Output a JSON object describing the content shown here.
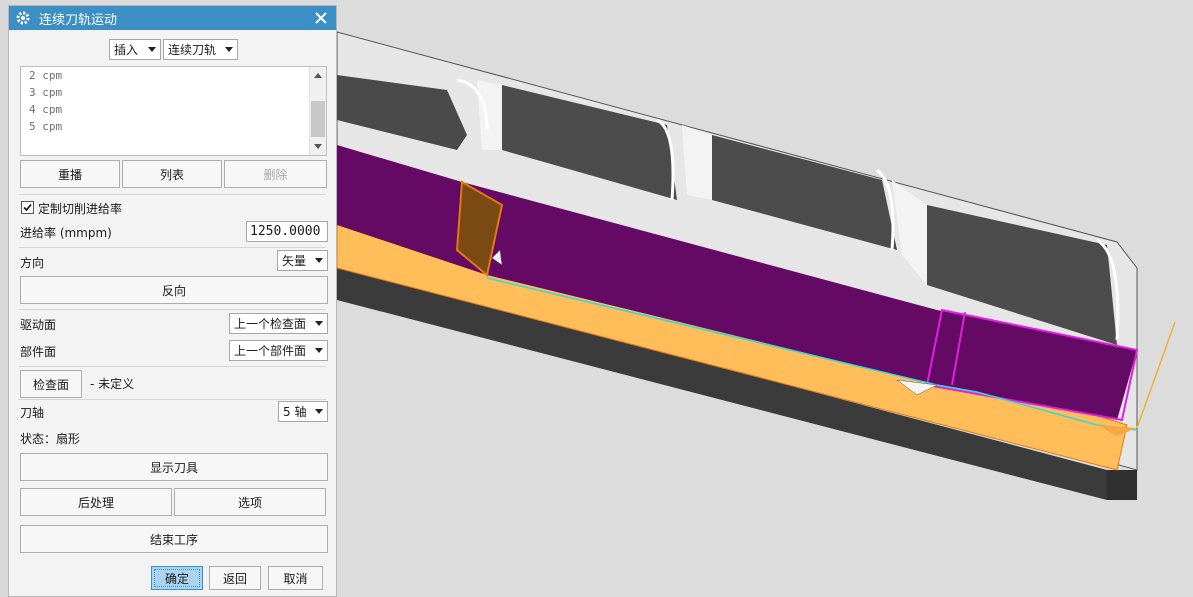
{
  "dialog": {
    "title": "连续刀轨运动",
    "insert_combo": "插入",
    "type_combo": "连续刀轨",
    "list_items": [
      "2  cpm",
      "3  cpm",
      "4  cpm",
      "5  cpm"
    ],
    "replay_button": "重播",
    "list_button": "列表",
    "delete_button": "删除",
    "custom_feed_label": "定制切削进给率",
    "custom_feed_checked": true,
    "feed_rate_label": "进给率 (mmpm)",
    "feed_rate_value": "1250.0000",
    "direction_label": "方向",
    "direction_value": "矢量",
    "reverse_button": "反向",
    "drive_surface_label": "驱动面",
    "drive_surface_value": "上一个检查面",
    "part_surface_label": "部件面",
    "part_surface_value": "上一个部件面",
    "check_surface_button": "检查面",
    "check_surface_status": "- 未定义",
    "tool_axis_label": "刀轴",
    "tool_axis_value": "5 轴",
    "status_text": "状态：扇形",
    "show_tool_button": "显示刀具",
    "postprocess_button": "后处理",
    "options_button": "选项",
    "end_operation_button": "结束工序",
    "ok_button": "确定",
    "back_button": "返回",
    "cancel_button": "取消"
  },
  "colors": {
    "titlebar": "#3c8fc4",
    "part_orange": "#ffbe5a",
    "wall_purple": "#650a64",
    "pocket_gray": "#4a4a4a",
    "highlight_magenta": "#e21fe0",
    "toolpath_cyan": "#30d8e0"
  },
  "icons": [
    "gear-icon",
    "close-icon",
    "checkmark-icon"
  ]
}
